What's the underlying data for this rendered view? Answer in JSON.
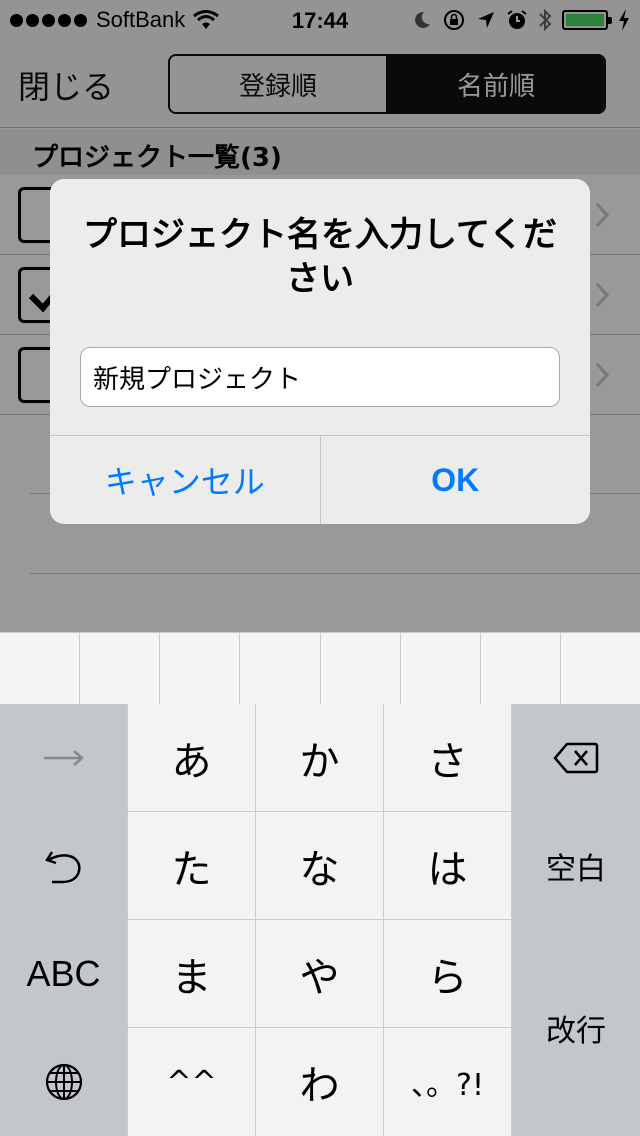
{
  "status_bar": {
    "carrier": "SoftBank",
    "time": "17:44",
    "battery_color": "#4cd964"
  },
  "nav": {
    "close_label": "閉じる",
    "segments": [
      "登録順",
      "名前順"
    ],
    "selected_segment": "名前順"
  },
  "list": {
    "section_title": "プロジェクト一覧(3)",
    "rows": [
      {
        "checked": false
      },
      {
        "checked": true
      },
      {
        "checked": false
      }
    ]
  },
  "alert": {
    "title": "プロジェクト名を入力してください",
    "input_value": "新規プロジェクト",
    "cancel_label": "キャンセル",
    "ok_label": "OK",
    "button_color": "#007aff"
  },
  "keyboard": {
    "kana": [
      "あ",
      "か",
      "さ",
      "た",
      "な",
      "は",
      "ま",
      "や",
      "ら",
      "^^",
      "わ",
      "、。?!"
    ],
    "abc_label": "ABC",
    "space_label": "空白",
    "return_label": "改行",
    "icons": [
      "next-arrow-icon",
      "backspace-icon",
      "undo-icon",
      "globe-icon"
    ]
  }
}
